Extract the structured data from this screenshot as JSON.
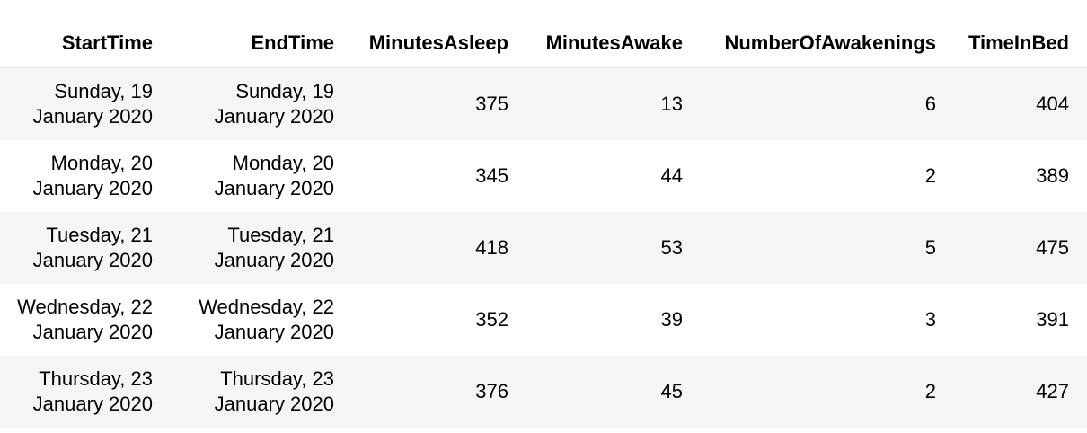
{
  "table": {
    "columns": [
      "StartTime",
      "EndTime",
      "MinutesAsleep",
      "MinutesAwake",
      "NumberOfAwakenings",
      "TimeInBed"
    ],
    "rows": [
      {
        "start_line1": "Sunday, 19",
        "start_line2": "January 2020",
        "end_line1": "Sunday, 19",
        "end_line2": "January 2020",
        "asleep": "375",
        "awake": "13",
        "awakenings": "6",
        "in_bed": "404"
      },
      {
        "start_line1": "Monday, 20",
        "start_line2": "January 2020",
        "end_line1": "Monday, 20",
        "end_line2": "January 2020",
        "asleep": "345",
        "awake": "44",
        "awakenings": "2",
        "in_bed": "389"
      },
      {
        "start_line1": "Tuesday, 21",
        "start_line2": "January 2020",
        "end_line1": "Tuesday, 21",
        "end_line2": "January 2020",
        "asleep": "418",
        "awake": "53",
        "awakenings": "5",
        "in_bed": "475"
      },
      {
        "start_line1": "Wednesday, 22",
        "start_line2": "January 2020",
        "end_line1": "Wednesday, 22",
        "end_line2": "January 2020",
        "asleep": "352",
        "awake": "39",
        "awakenings": "3",
        "in_bed": "391"
      },
      {
        "start_line1": "Thursday, 23",
        "start_line2": "January 2020",
        "end_line1": "Thursday, 23",
        "end_line2": "January 2020",
        "asleep": "376",
        "awake": "45",
        "awakenings": "2",
        "in_bed": "427"
      }
    ]
  },
  "colors": {
    "striped_row": "#f5f5f5",
    "text": "#000000",
    "background": "#ffffff"
  }
}
